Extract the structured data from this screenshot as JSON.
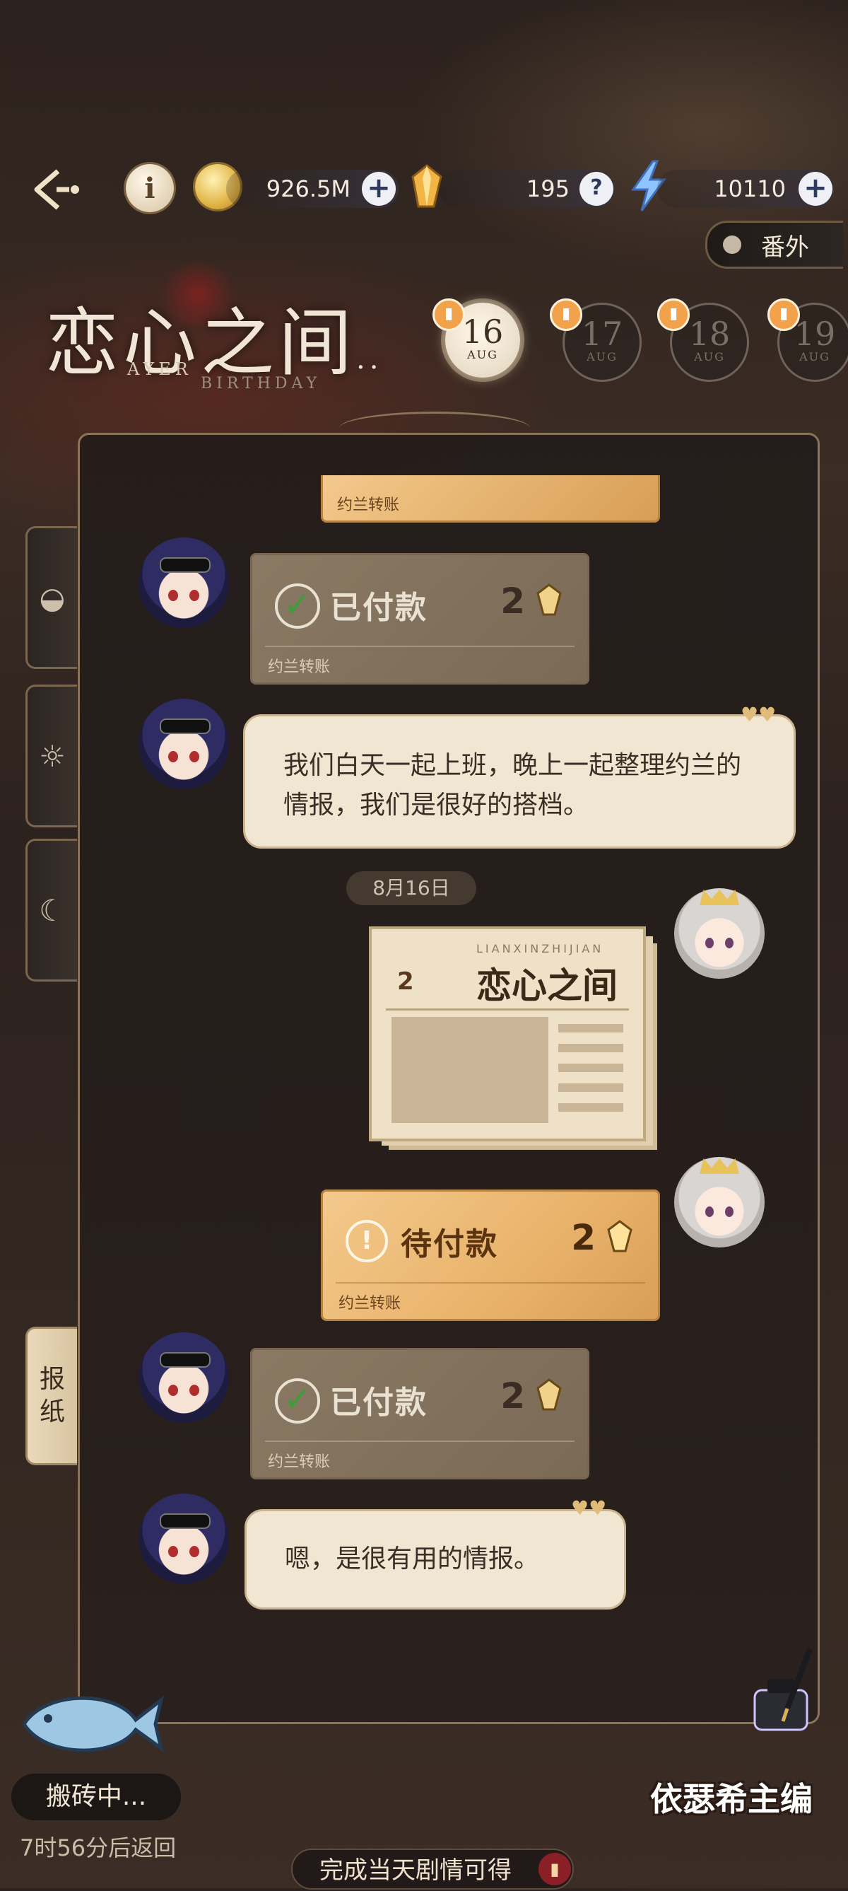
{
  "header": {
    "coins": "926.5M",
    "gems": "195",
    "energy": "10110",
    "extra_label": "番外"
  },
  "title": {
    "main": "恋心之间",
    "sub1": "AYER",
    "sub2": "BIRTHDAY",
    "ellipsis": ".."
  },
  "dates": [
    {
      "day": "16",
      "month": "AUG"
    },
    {
      "day": "17",
      "month": "AUG"
    },
    {
      "day": "18",
      "month": "AUG"
    },
    {
      "day": "19",
      "month": "AUG"
    }
  ],
  "side_tabs": {
    "newspaper": [
      "报",
      "纸"
    ]
  },
  "messages": {
    "top_cut_label": "约兰转账",
    "t1": {
      "status": "已付款",
      "amount": "2",
      "sub": "约兰转账"
    },
    "m1": "我们白天一起上班，晚上一起整理约兰的情报，我们是很好的搭档。",
    "date_divider": "8月16日",
    "newspaper": {
      "latin": "LIANXINZHIJIAN",
      "title": "恋心之间",
      "price": "2"
    },
    "t2": {
      "status": "待付款",
      "amount": "2",
      "sub": "约兰转账"
    },
    "t3": {
      "status": "已付款",
      "amount": "2",
      "sub": "约兰转账"
    },
    "m2": "嗯，是很有用的情报。"
  },
  "footer": {
    "working": "搬砖中...",
    "return_time": "7时56分后返回",
    "complete": "完成当天剧情可得",
    "editor": "依瑟希主编"
  },
  "colors": {
    "accent_gold": "#e9b26a",
    "frame": "#8a7458",
    "paid_card": "#8a7a64"
  }
}
